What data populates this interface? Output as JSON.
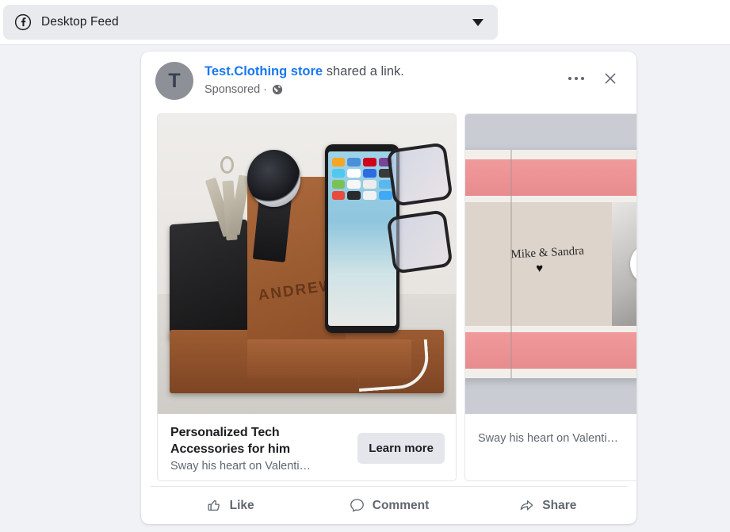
{
  "placement": {
    "icon": "facebook-logo-icon",
    "label": "Desktop Feed",
    "caret": "chevron-down-icon"
  },
  "ad": {
    "avatar_initial": "T",
    "page_name": "Test.Clothing store",
    "shared_text": " shared a link.",
    "sponsored_label": "Sponsored",
    "separator": "·",
    "privacy_icon": "globe-icon",
    "more_options": "ellipsis-menu",
    "close": "close-icon",
    "carousel": {
      "next_arrow": "chevron-right-icon",
      "cards": [
        {
          "image_alt": "wooden-docking-station",
          "engraved_name": "ANDREW",
          "title": "Personalized Tech Accessories for him",
          "description": "Sway his heart on Valenti…",
          "cta_label": "Learn more"
        },
        {
          "image_alt": "personalized-photo-book",
          "book_names": "Mike & Sandra",
          "book_heart": "♥",
          "title": "",
          "description": "Sway his heart on Valenti…",
          "cta_label": ""
        }
      ]
    },
    "actions": [
      {
        "label": "Like",
        "icon": "thumbs-up-icon"
      },
      {
        "label": "Comment",
        "icon": "comment-bubble-icon"
      },
      {
        "label": "Share",
        "icon": "share-arrow-icon"
      }
    ]
  },
  "colors": {
    "page_bg": "#f0f2f5",
    "link_blue": "#1877f2",
    "card_white": "#ffffff",
    "button_gray": "#e4e6eb",
    "text_primary": "#1c1e21",
    "text_secondary": "#606770",
    "band_pink": "#e88c8e",
    "wood_brown": "#8d4f28"
  }
}
